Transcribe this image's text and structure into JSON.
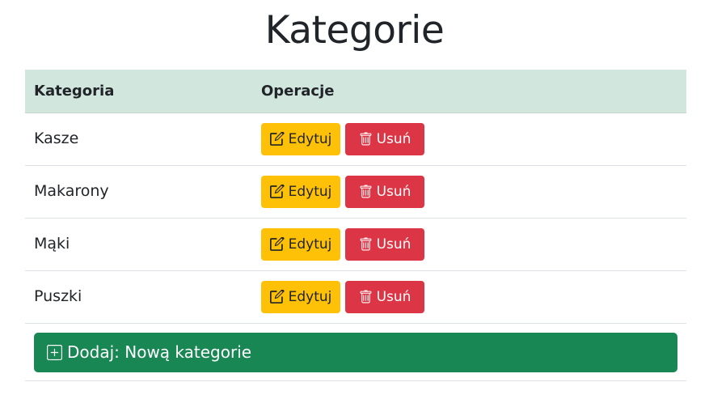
{
  "page": {
    "title": "Kategorie"
  },
  "table": {
    "headers": {
      "category": "Kategoria",
      "operations": "Operacje"
    },
    "rows": [
      {
        "name": "Kasze",
        "edit_label": "Edytuj",
        "delete_label": "Usuń"
      },
      {
        "name": "Makarony",
        "edit_label": "Edytuj",
        "delete_label": "Usuń"
      },
      {
        "name": "Mąki",
        "edit_label": "Edytuj",
        "delete_label": "Usuń"
      },
      {
        "name": "Puszki",
        "edit_label": "Edytuj",
        "delete_label": "Usuń"
      }
    ]
  },
  "add_button": {
    "label": "Dodaj: Nową kategorie",
    "icon": "plus-square-icon"
  },
  "icons": {
    "edit": "pencil-square-icon",
    "delete": "trash-icon"
  },
  "colors": {
    "header_bg": "#d1e7dd",
    "edit": "#ffc107",
    "delete": "#dc3545",
    "add": "#198754"
  }
}
